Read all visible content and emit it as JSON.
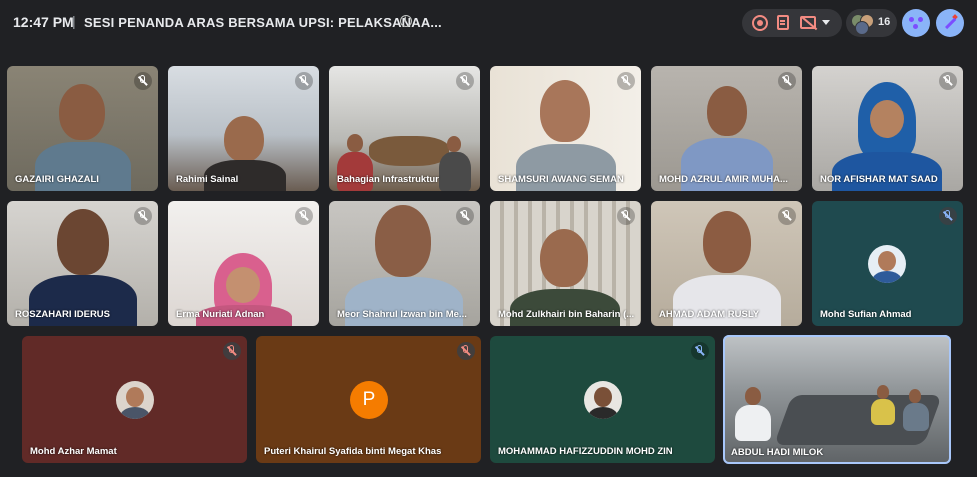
{
  "header": {
    "time": "12:47 PM",
    "separator": "|",
    "meeting_title": "SESI PENANDA ARAS BERSAMA UPSI: PELAKSANAA...",
    "info_icon": "info-icon",
    "participant_count": "16"
  },
  "colors": {
    "background": "#202124",
    "control_pill": "#35363a",
    "alert_red": "#f28b82",
    "accent_blue": "#8ab4f8",
    "orange_avatar": "#f57c00"
  },
  "participants": [
    {
      "name": "GAZAIRI GHAZALI",
      "mic": "muted"
    },
    {
      "name": "Rahimi Sainal",
      "mic": "muted"
    },
    {
      "name": "Bahagian Infrastruktur",
      "mic": "muted"
    },
    {
      "name": "SHAMSURI AWANG SEMAN",
      "mic": "muted"
    },
    {
      "name": "MOHD AZRUL AMIR MUHA...",
      "mic": "muted"
    },
    {
      "name": "NOR AFISHAR MAT SAAD",
      "mic": "muted"
    },
    {
      "name": "ROSZAHARI IDERUS",
      "mic": "muted"
    },
    {
      "name": "Erma Nuriati Adnan",
      "mic": "muted"
    },
    {
      "name": "Meor Shahrul Izwan bin Me...",
      "mic": "muted"
    },
    {
      "name": "Mohd Zulkhairi bin Baharin (...",
      "mic": "muted"
    },
    {
      "name": "AHMAD ADAM RUSLY",
      "mic": "muted"
    },
    {
      "name": "Mohd Sufian Ahmad",
      "mic": "muted"
    },
    {
      "name": "Mohd Azhar Mamat",
      "mic": "muted"
    },
    {
      "name": "Puteri Khairul Syafida binti Megat Khas",
      "mic": "muted"
    },
    {
      "name": "MOHAMMAD HAFIZZUDDIN MOHD ZIN",
      "mic": "muted"
    },
    {
      "name": "ABDUL HADI MILOK",
      "mic": "unmuted"
    }
  ],
  "letter_avatar": "P"
}
